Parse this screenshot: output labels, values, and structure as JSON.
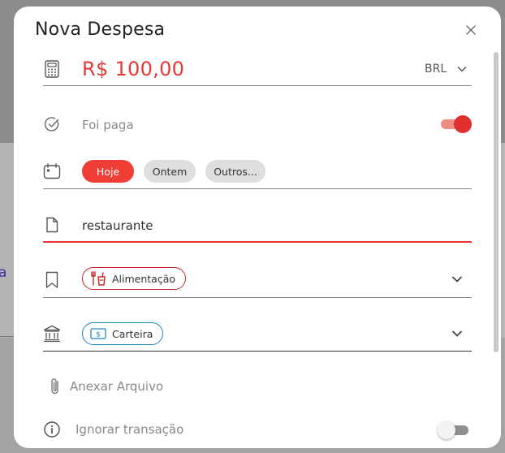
{
  "dialog": {
    "title": "Nova Despesa",
    "amount": "R$ 100,00",
    "currency": "BRL",
    "paid_label": "Foi paga",
    "paid": true,
    "date_options": [
      "Hoje",
      "Ontem",
      "Outros..."
    ],
    "selected_date": "Hoje",
    "description": "restaurante",
    "category": "Alimentação",
    "account": "Carteira",
    "attach_label": "Anexar Arquivo",
    "ignore_label": "Ignorar transação",
    "ignore": false
  },
  "colors": {
    "accent": "#e53935",
    "category_border": "#c62828",
    "account_border": "#1e88b5"
  },
  "icons": {
    "amount": "calculator-icon",
    "paid": "check-circle-icon",
    "date": "calendar-icon",
    "description": "file-icon",
    "category": "bookmark-icon",
    "category_tag": "food-icon",
    "account": "bank-icon",
    "account_tag": "money-icon",
    "attach": "paperclip-icon",
    "ignore": "info-icon",
    "close": "close-icon",
    "dropdown": "chevron-down-icon"
  }
}
